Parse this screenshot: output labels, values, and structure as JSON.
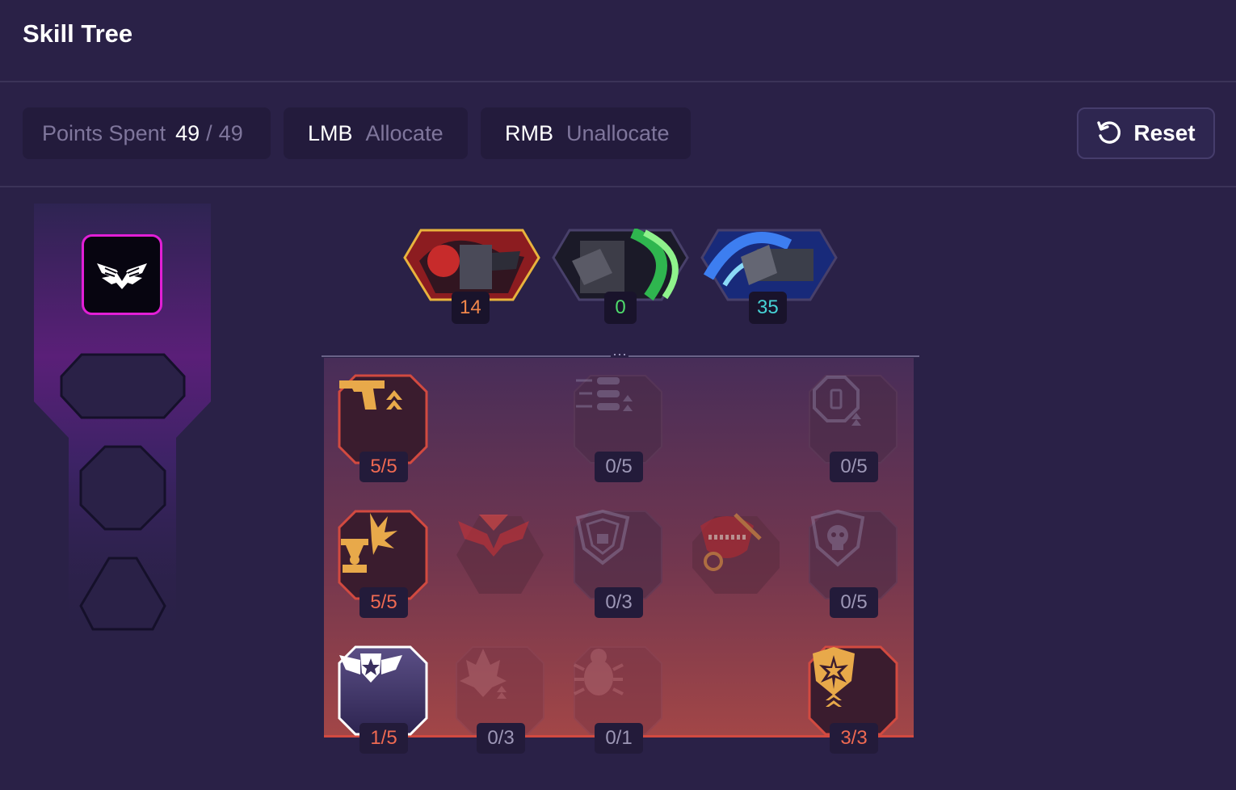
{
  "header": {
    "title": "Skill Tree"
  },
  "toolbar": {
    "points_label": "Points Spent",
    "points_spent": "49",
    "points_separator": "/",
    "points_total": "49",
    "lmb_key": "LMB",
    "lmb_action": "Allocate",
    "rmb_key": "RMB",
    "rmb_action": "Unallocate",
    "reset_label": "Reset"
  },
  "heroes": [
    {
      "name": "red-hero",
      "count": "14",
      "color": "#f0864a"
    },
    {
      "name": "green-hero",
      "count": "0",
      "color": "#4fdc6c"
    },
    {
      "name": "blue-hero",
      "count": "35",
      "color": "#46d3d6"
    }
  ],
  "skills": [
    {
      "icon": "pistol-icon",
      "rank": "5/5",
      "active": true
    },
    {
      "icon": "bullets-icon",
      "rank": "0/5",
      "active": false
    },
    {
      "icon": "battery-shield-icon",
      "rank": "0/5",
      "active": false
    },
    {
      "icon": "explosion-trophy-icon",
      "rank": "5/5",
      "active": true
    },
    {
      "icon": "chevron-emblem-icon",
      "rank": "",
      "active": false
    },
    {
      "icon": "shield-emblem-icon",
      "rank": "0/3",
      "active": false
    },
    {
      "icon": "chomper-icon",
      "rank": "",
      "active": false
    },
    {
      "icon": "skull-shield-icon",
      "rank": "0/5",
      "active": false
    },
    {
      "icon": "winged-star-icon",
      "rank": "1/5",
      "active": true
    },
    {
      "icon": "flame-icon",
      "rank": "0/3",
      "active": false
    },
    {
      "icon": "beetle-icon",
      "rank": "0/1",
      "active": false
    },
    {
      "icon": "star-shield-icon",
      "rank": "3/3",
      "active": true
    }
  ],
  "colors": {
    "accent_magenta": "#e21fd6",
    "active_rank": "#ef6a52",
    "active_border": "#d24a40",
    "gold": "#e8a94a"
  }
}
